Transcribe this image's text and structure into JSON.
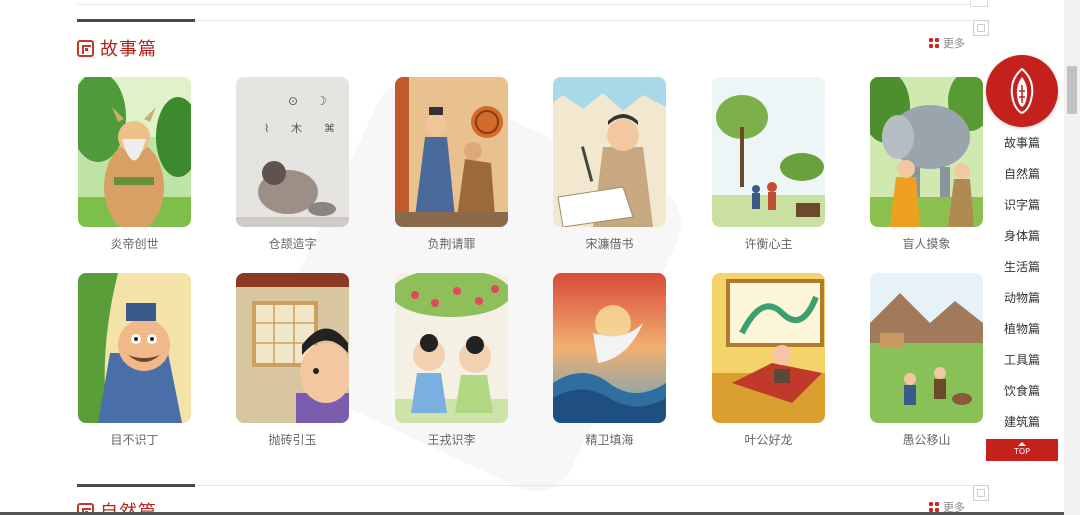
{
  "sections": [
    {
      "title": "故事篇",
      "more": "更多",
      "items": [
        {
          "caption": "炎帝创世"
        },
        {
          "caption": "仓颉造字"
        },
        {
          "caption": "负荆请罪"
        },
        {
          "caption": "宋濂借书"
        },
        {
          "caption": "许衡心主"
        },
        {
          "caption": "盲人摸象"
        },
        {
          "caption": "目不识丁"
        },
        {
          "caption": "抛砖引玉"
        },
        {
          "caption": "王戎识李"
        },
        {
          "caption": "精卫填海"
        },
        {
          "caption": "叶公好龙"
        },
        {
          "caption": "愚公移山"
        }
      ]
    },
    {
      "title": "自然篇",
      "more": "更多"
    }
  ],
  "sidebar": {
    "items": [
      "故事篇",
      "自然篇",
      "识字篇",
      "身体篇",
      "生活篇",
      "动物篇",
      "植物篇",
      "工具篇",
      "饮食篇",
      "建筑篇"
    ],
    "top_label": "TOP"
  },
  "colors": {
    "accent": "#c4201c",
    "title": "#b0261c"
  }
}
